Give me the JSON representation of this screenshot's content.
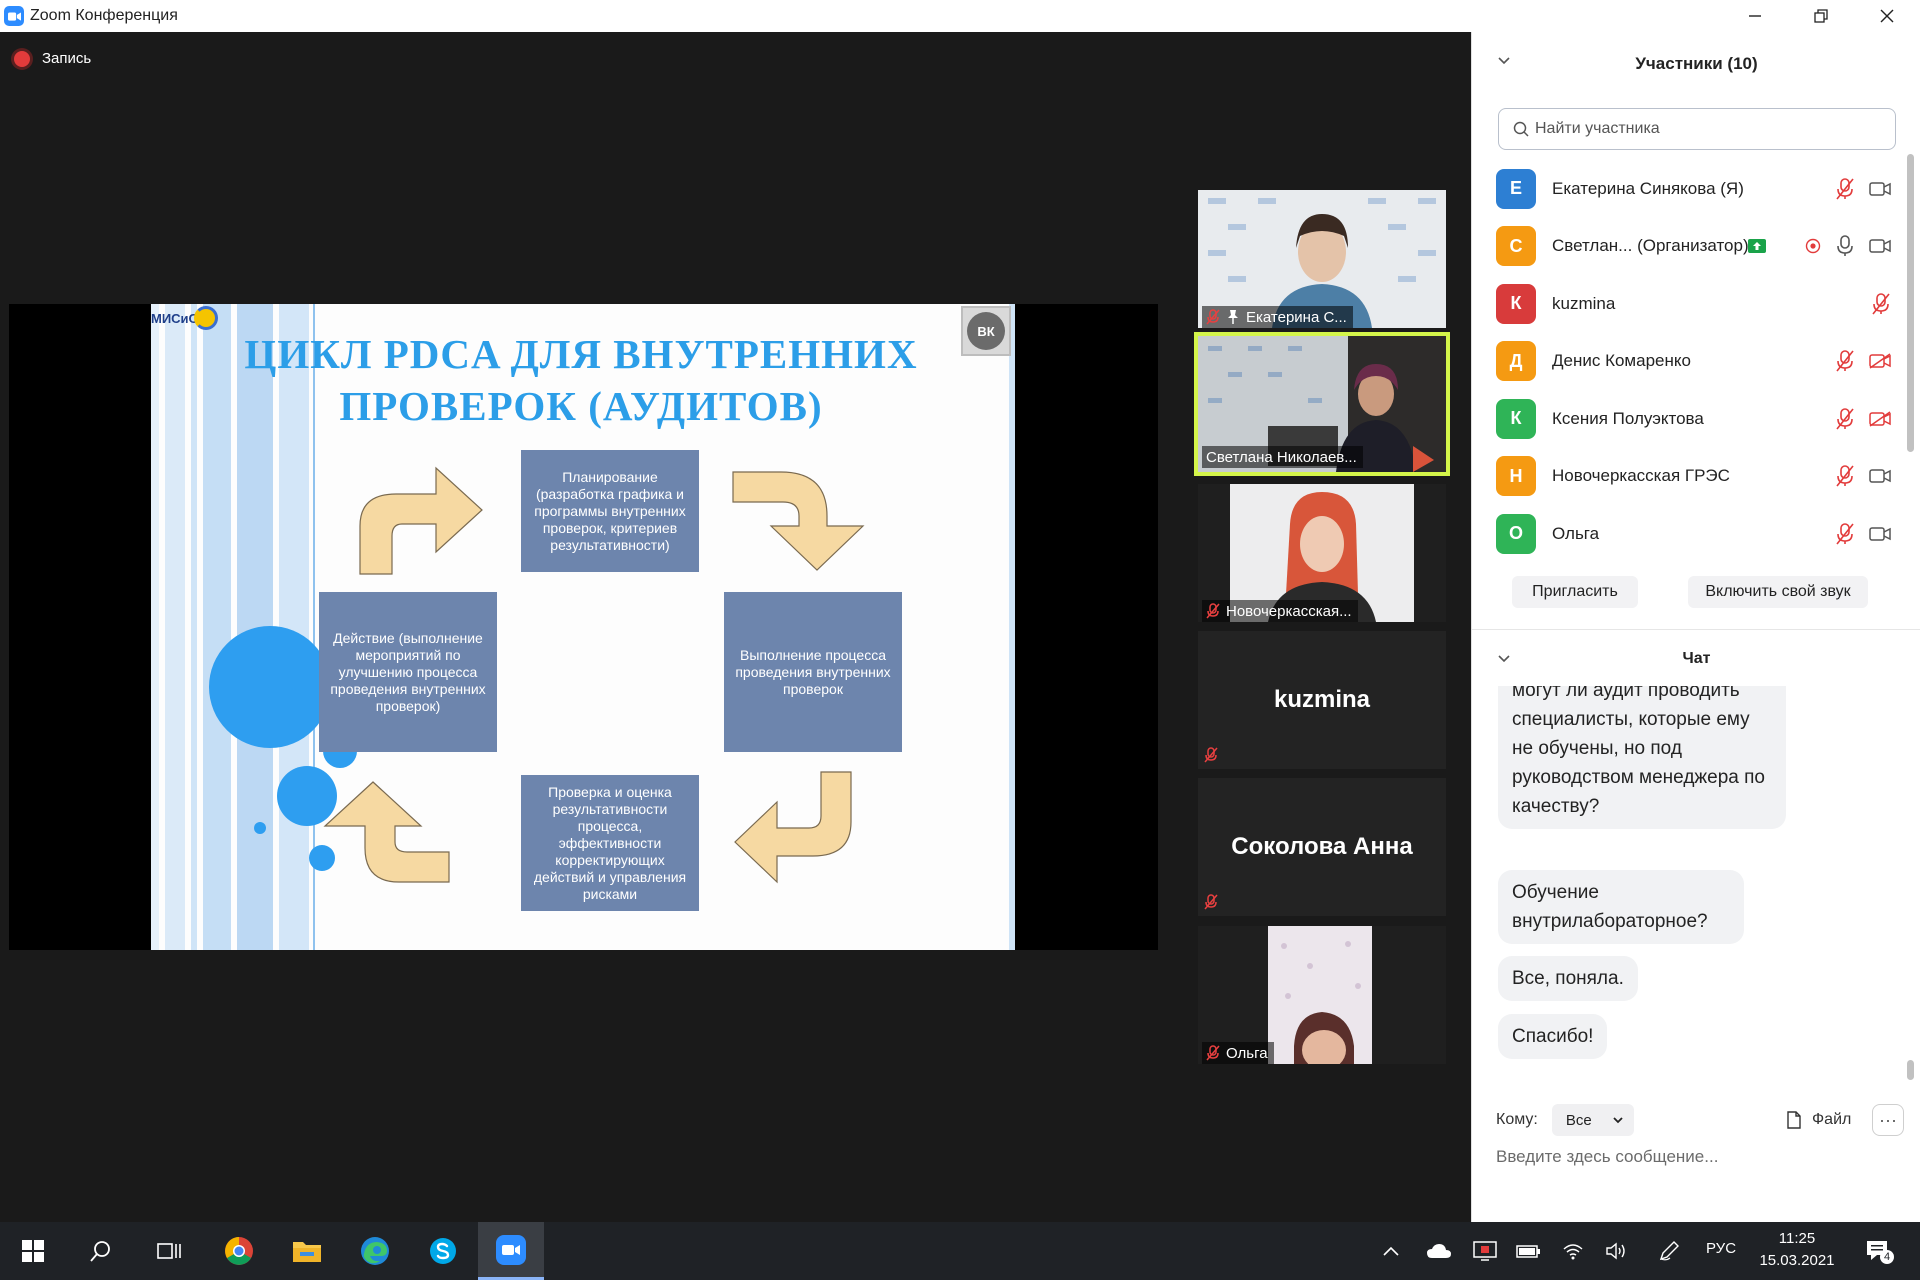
{
  "window": {
    "title": "Zoom Конференция"
  },
  "recording": {
    "label": "Запись"
  },
  "slide": {
    "title_line1": "ЦИКЛ PDCA ДЛЯ ВНУТРЕННИХ",
    "title_line2": "ПРОВЕРОК (АУДИТОВ)",
    "logo_text": "МИСиС",
    "vk_text": "ВК",
    "boxes": {
      "plan": "Планирование (разработка графика и программы внутренних проверок, критериев результативности)",
      "do": "Выполнение процесса проведения внутренних проверок",
      "check": "Проверка и оценка результативности процесса, эффективности корректирующих действий и управления рисками",
      "act": "Действие (выполнение мероприятий по улучшению процесса проведения внутренних проверок)"
    }
  },
  "gallery": [
    {
      "name": "Екатерина С...",
      "muted": true,
      "pinned": true
    },
    {
      "name": "Светлана Николаев...",
      "muted": false,
      "active": true
    },
    {
      "name": "Новочеркасская...",
      "muted": true
    },
    {
      "name": "kuzmina",
      "muted": true,
      "no_video": true
    },
    {
      "name": "Соколова Анна",
      "muted": true,
      "no_video": true
    },
    {
      "name": "Ольга",
      "muted": true
    }
  ],
  "participants": {
    "header": "Участники (10)",
    "search_placeholder": "Найти участника",
    "list": [
      {
        "initial": "Е",
        "name": "Екатерина Синякова (Я)",
        "color": "#2d7fd3",
        "mic": "muted",
        "video": "on"
      },
      {
        "initial": "С",
        "name": "Светлан... (Организатор)",
        "color": "#f59a12",
        "mic": "on",
        "video": "on",
        "sharing": true,
        "recording": true
      },
      {
        "initial": "К",
        "name": "kuzmina",
        "color": "#d83b3b",
        "mic": "muted",
        "video": "none"
      },
      {
        "initial": "Д",
        "name": "Денис Комаренко",
        "color": "#f59a12",
        "mic": "muted",
        "video": "off"
      },
      {
        "initial": "К",
        "name": "Ксения Полуэктова",
        "color": "#2fb457",
        "mic": "muted",
        "video": "off"
      },
      {
        "initial": "Н",
        "name": "Новочеркасская ГРЭС",
        "color": "#f59a12",
        "mic": "muted",
        "video": "on"
      },
      {
        "initial": "О",
        "name": "Ольга",
        "color": "#2fb457",
        "mic": "muted",
        "video": "on"
      }
    ],
    "invite_label": "Пригласить",
    "unmute_label": "Включить свой звук"
  },
  "chat": {
    "header": "Чат",
    "messages": [
      "могут ли аудит проводить специалисты, которые ему не обучены, но под руководством менеджера по качеству?",
      "Обучение внутрилабораторное?",
      "Все, поняла.",
      "Спасибо!"
    ],
    "to_label": "Кому:",
    "to_value": "Все",
    "file_label": "Файл",
    "more_label": "···",
    "input_placeholder": "Введите здесь сообщение..."
  },
  "taskbar": {
    "lang": "РУС",
    "time": "11:25",
    "date": "15.03.2021",
    "notifications": "4"
  },
  "colors": {
    "zoom_blue": "#2d8cff",
    "slide_title": "#2c9ee8",
    "box_fill": "#6d85ad",
    "arrow_fill": "#f6d9a2",
    "active_border": "#d4f54a"
  }
}
